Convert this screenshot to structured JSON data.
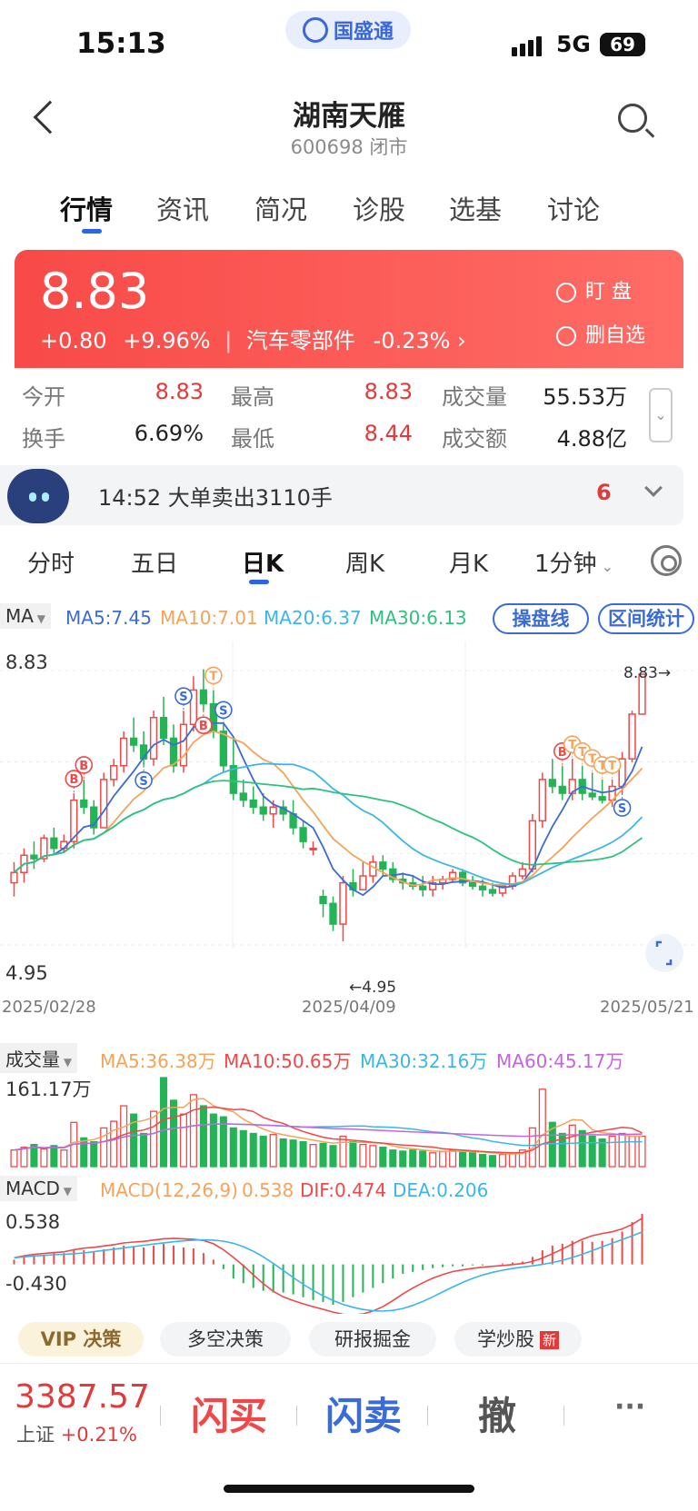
{
  "status_bar": {
    "time": "15:13",
    "brand": "国盛通",
    "network": "5G",
    "battery": "69"
  },
  "header": {
    "title": "湖南天雁",
    "subtitle": "600698 闭市"
  },
  "tabs": [
    "行情",
    "资讯",
    "简况",
    "诊股",
    "选基",
    "讨论"
  ],
  "quote": {
    "price": "8.83",
    "change": "+0.80",
    "change_pct": "+9.96%",
    "sector": "汽车零部件",
    "sector_pct": "-0.23%",
    "watch_label": "盯 盘",
    "fav_label": "删自选"
  },
  "stats": [
    {
      "label": "今开",
      "value": "8.83",
      "red": true
    },
    {
      "label": "最高",
      "value": "8.83",
      "red": true
    },
    {
      "label": "成交量",
      "value": "55.53万",
      "red": false
    },
    {
      "label": "换手",
      "value": "6.69%",
      "red": false
    },
    {
      "label": "最低",
      "value": "8.44",
      "red": true
    },
    {
      "label": "成交额",
      "value": "4.88亿",
      "red": false
    }
  ],
  "news": {
    "text": "14:52 大单卖出3110手",
    "count": "6"
  },
  "kline_tabs": [
    "分时",
    "五日",
    "日K",
    "周K",
    "月K",
    "1分钟"
  ],
  "ma_legend": {
    "tag": "MA",
    "items": [
      {
        "label": "MA5:7.45",
        "color": "#3a6bd8"
      },
      {
        "label": "MA10:7.01",
        "color": "#f5a35a"
      },
      {
        "label": "MA20:6.37",
        "color": "#3bb6e8"
      },
      {
        "label": "MA30:6.13",
        "color": "#2ec27e"
      }
    ],
    "btn1": "操盘线",
    "btn2": "区间统计"
  },
  "colors": {
    "up": "#f04848",
    "down": "#22b455",
    "ma5": "#3a6bd8",
    "ma10": "#f5a35a",
    "ma20": "#3bb6e8",
    "ma30": "#2ec27e",
    "ma60": "#c465e0"
  },
  "chart_data": [
    {
      "type": "candlestick",
      "title": "日K",
      "y_max_label": "8.83",
      "y_min_label": "4.95",
      "ylim": [
        4.95,
        8.83
      ],
      "x_tick_labels": [
        "2025/02/28",
        "2025/04/09",
        "2025/05/21"
      ],
      "annotations": {
        "high": "8.83→",
        "low": "←4.95"
      },
      "ohlc": [
        [
          5.8,
          6.1,
          5.6,
          5.95
        ],
        [
          5.95,
          6.3,
          5.8,
          6.2
        ],
        [
          6.2,
          6.4,
          6.0,
          6.15
        ],
        [
          6.15,
          6.5,
          6.1,
          6.45
        ],
        [
          6.45,
          6.6,
          6.2,
          6.3
        ],
        [
          6.3,
          6.5,
          6.25,
          6.4
        ],
        [
          6.4,
          7.1,
          6.3,
          7.0
        ],
        [
          7.0,
          7.3,
          6.8,
          6.9
        ],
        [
          6.9,
          7.0,
          6.5,
          6.6
        ],
        [
          6.6,
          7.4,
          6.6,
          7.3
        ],
        [
          7.3,
          7.6,
          7.2,
          7.5
        ],
        [
          7.5,
          8.0,
          7.4,
          7.9
        ],
        [
          7.9,
          8.2,
          7.7,
          7.8
        ],
        [
          7.8,
          8.0,
          7.5,
          7.6
        ],
        [
          7.6,
          8.3,
          7.5,
          8.2
        ],
        [
          8.2,
          8.5,
          7.8,
          7.9
        ],
        [
          7.9,
          8.1,
          7.4,
          7.5
        ],
        [
          7.5,
          8.3,
          7.4,
          8.1
        ],
        [
          8.1,
          8.8,
          8.0,
          8.6
        ],
        [
          8.6,
          8.9,
          8.3,
          8.4
        ],
        [
          8.4,
          8.6,
          7.9,
          8.0
        ],
        [
          8.0,
          8.1,
          7.4,
          7.5
        ],
        [
          7.5,
          7.9,
          7.0,
          7.1
        ],
        [
          7.1,
          7.3,
          6.9,
          7.0
        ],
        [
          7.0,
          7.2,
          6.8,
          6.9
        ],
        [
          6.9,
          7.1,
          6.7,
          6.8
        ],
        [
          6.8,
          7.0,
          6.6,
          6.9
        ],
        [
          6.9,
          7.0,
          6.7,
          6.8
        ],
        [
          6.8,
          7.0,
          6.5,
          6.6
        ],
        [
          6.6,
          6.7,
          6.3,
          6.4
        ],
        [
          6.3,
          6.4,
          6.2,
          6.3
        ],
        [
          5.6,
          5.7,
          5.3,
          5.5
        ],
        [
          5.5,
          5.6,
          5.1,
          5.2
        ],
        [
          5.2,
          5.9,
          4.95,
          5.8
        ],
        [
          5.8,
          6.0,
          5.6,
          5.7
        ],
        [
          5.7,
          6.1,
          5.7,
          5.9
        ],
        [
          5.9,
          6.2,
          5.8,
          6.1
        ],
        [
          6.1,
          6.2,
          5.9,
          6.0
        ],
        [
          6.0,
          6.1,
          5.8,
          5.85
        ],
        [
          5.85,
          5.95,
          5.7,
          5.8
        ],
        [
          5.8,
          5.9,
          5.7,
          5.75
        ],
        [
          5.75,
          5.9,
          5.6,
          5.7
        ],
        [
          5.7,
          5.9,
          5.6,
          5.8
        ],
        [
          5.8,
          5.9,
          5.7,
          5.85
        ],
        [
          5.85,
          6.0,
          5.8,
          5.95
        ],
        [
          5.95,
          6.0,
          5.75,
          5.8
        ],
        [
          5.8,
          5.9,
          5.7,
          5.75
        ],
        [
          5.75,
          5.85,
          5.6,
          5.7
        ],
        [
          5.7,
          5.8,
          5.6,
          5.65
        ],
        [
          5.65,
          5.8,
          5.6,
          5.75
        ],
        [
          5.75,
          5.95,
          5.7,
          5.9
        ],
        [
          5.9,
          6.1,
          5.85,
          6.0
        ],
        [
          6.0,
          6.8,
          5.95,
          6.7
        ],
        [
          6.7,
          7.4,
          6.6,
          7.3
        ],
        [
          7.3,
          7.6,
          7.1,
          7.2
        ],
        [
          7.2,
          7.5,
          7.0,
          7.1
        ],
        [
          7.1,
          7.6,
          7.0,
          7.3
        ],
        [
          7.3,
          7.5,
          7.0,
          7.1
        ],
        [
          7.1,
          7.4,
          7.0,
          7.05
        ],
        [
          7.05,
          7.3,
          6.95,
          7.0
        ],
        [
          7.0,
          7.3,
          6.9,
          7.2
        ],
        [
          7.2,
          7.7,
          7.1,
          7.6
        ],
        [
          7.6,
          8.3,
          7.55,
          8.25
        ],
        [
          8.25,
          8.83,
          8.25,
          8.83
        ]
      ],
      "markers": [
        {
          "i": 6,
          "label": "B",
          "color": "#f04848",
          "pos": "above"
        },
        {
          "i": 7,
          "label": "B",
          "color": "#f04848",
          "pos": "above"
        },
        {
          "i": 13,
          "label": "S",
          "color": "#3a6bd8",
          "pos": "below"
        },
        {
          "i": 17,
          "label": "S",
          "color": "#3a6bd8",
          "pos": "above"
        },
        {
          "i": 19,
          "label": "B",
          "color": "#f04848",
          "pos": "below"
        },
        {
          "i": 20,
          "label": "T",
          "color": "#f5a35a",
          "pos": "above"
        },
        {
          "i": 21,
          "label": "S",
          "color": "#3a6bd8",
          "pos": "above"
        },
        {
          "i": 55,
          "label": "B",
          "color": "#f04848",
          "pos": "above"
        },
        {
          "i": 56,
          "label": "T",
          "color": "#f5a35a",
          "pos": "above"
        },
        {
          "i": 57,
          "label": "T",
          "color": "#f5a35a",
          "pos": "above"
        },
        {
          "i": 58,
          "label": "T",
          "color": "#f5a35a",
          "pos": "above"
        },
        {
          "i": 59,
          "label": "T",
          "color": "#f5a35a",
          "pos": "above"
        },
        {
          "i": 60,
          "label": "T",
          "color": "#f5a35a",
          "pos": "above"
        },
        {
          "i": 61,
          "label": "S",
          "color": "#3a6bd8",
          "pos": "below"
        }
      ]
    },
    {
      "type": "bar",
      "title": "成交量",
      "y_max_label": "161.17万",
      "legend": [
        {
          "label": "MA5:36.38万",
          "color": "#f5a35a"
        },
        {
          "label": "MA10:50.65万",
          "color": "#f04848"
        },
        {
          "label": "MA30:32.16万",
          "color": "#3bb6e8"
        },
        {
          "label": "MA60:45.17万",
          "color": "#c465e0"
        }
      ],
      "volumes": [
        30,
        35,
        40,
        32,
        38,
        30,
        80,
        52,
        45,
        70,
        82,
        110,
        95,
        60,
        100,
        161,
        120,
        95,
        130,
        110,
        95,
        90,
        70,
        65,
        60,
        55,
        58,
        50,
        48,
        45,
        40,
        42,
        38,
        55,
        45,
        40,
        38,
        35,
        30,
        28,
        30,
        28,
        25,
        27,
        30,
        28,
        25,
        22,
        20,
        22,
        25,
        30,
        70,
        140,
        80,
        60,
        75,
        65,
        55,
        50,
        55,
        60,
        55,
        55
      ]
    },
    {
      "type": "bar",
      "title": "MACD",
      "legend": [
        {
          "label": "MACD(12,26,9)",
          "color": "#f5a35a"
        },
        {
          "label": "0.538",
          "color": "#f5a35a"
        },
        {
          "label": "DIF:0.474",
          "color": "#f04848"
        },
        {
          "label": "DEA:0.206",
          "color": "#3bb6e8"
        }
      ],
      "y_max_label": "0.538",
      "y_min_label": "-0.430",
      "ylim": [
        -0.43,
        0.538
      ],
      "macd": [
        0.05,
        0.08,
        0.1,
        0.1,
        0.12,
        0.12,
        0.15,
        0.15,
        0.14,
        0.16,
        0.18,
        0.2,
        0.19,
        0.18,
        0.2,
        0.22,
        0.2,
        0.18,
        0.17,
        0.12,
        0.05,
        -0.05,
        -0.15,
        -0.2,
        -0.25,
        -0.28,
        -0.3,
        -0.3,
        -0.32,
        -0.35,
        -0.38,
        -0.4,
        -0.43,
        -0.4,
        -0.35,
        -0.3,
        -0.25,
        -0.2,
        -0.15,
        -0.1,
        -0.08,
        -0.06,
        -0.04,
        -0.03,
        -0.02,
        -0.02,
        -0.01,
        -0.01,
        0.0,
        0.01,
        0.02,
        0.03,
        0.08,
        0.15,
        0.2,
        0.22,
        0.25,
        0.25,
        0.24,
        0.25,
        0.28,
        0.35,
        0.45,
        0.538
      ]
    }
  ],
  "chips": {
    "vip": "VIP 决策",
    "items": [
      "多空决策",
      "研报掘金",
      "学炒股"
    ],
    "new_badge": "新"
  },
  "bottom": {
    "index_value": "3387.57",
    "index_name": "上证",
    "index_pct": "+0.21%",
    "buy": "闪买",
    "sell": "闪卖",
    "cancel": "撤",
    "more": "···"
  }
}
